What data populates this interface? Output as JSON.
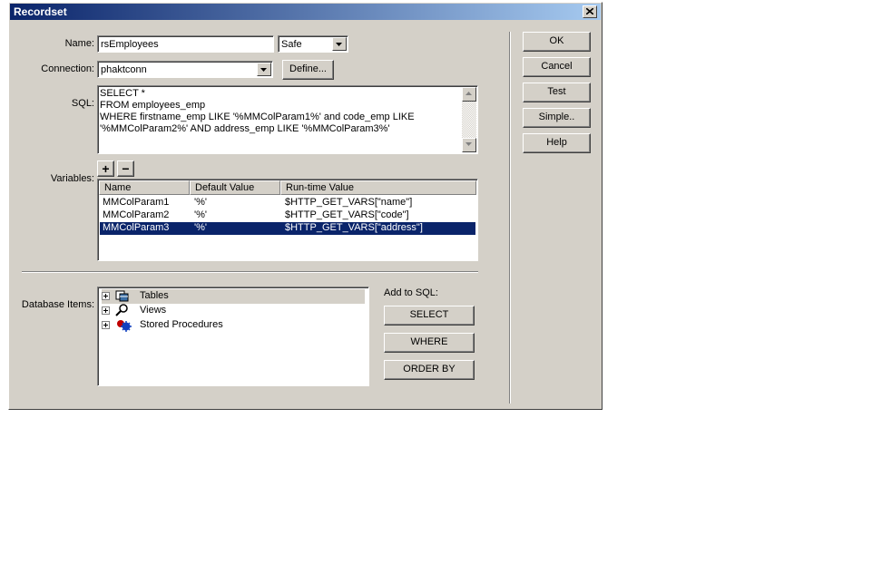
{
  "window": {
    "title": "Recordset"
  },
  "name_field": {
    "label": "Name:",
    "value": "rsEmployees"
  },
  "safety_select": {
    "value": "Safe"
  },
  "connection": {
    "label": "Connection:",
    "value": "phaktconn",
    "define_label": "Define..."
  },
  "sql": {
    "label": "SQL:",
    "lines": [
      "SELECT *",
      "FROM employees_emp",
      "WHERE firstname_emp LIKE '%MMColParam1%' and code_emp LIKE",
      "'%MMColParam2%' AND address_emp LIKE '%MMColParam3%'"
    ]
  },
  "variables": {
    "label": "Variables:",
    "add_label": "+",
    "remove_label": "−",
    "columns": [
      "Name",
      "Default Value",
      "Run-time Value"
    ],
    "rows": [
      {
        "name": "MMColParam1",
        "default": "'%'",
        "runtime": "$HTTP_GET_VARS[\"name\"]"
      },
      {
        "name": "MMColParam2",
        "default": "'%'",
        "runtime": "$HTTP_GET_VARS[\"code\"]"
      },
      {
        "name": "MMColParam3",
        "default": "'%'",
        "runtime": "$HTTP_GET_VARS[\"address\"]"
      }
    ],
    "selected_index": 2
  },
  "database_items": {
    "label": "Database Items:",
    "items": [
      {
        "label": "Tables",
        "icon": "tables-icon"
      },
      {
        "label": "Views",
        "icon": "views-icon"
      },
      {
        "label": "Stored Procedures",
        "icon": "stored-procedures-icon"
      }
    ]
  },
  "add_to_sql": {
    "label": "Add to SQL:",
    "select_label": "SELECT",
    "where_label": "WHERE",
    "order_by_label": "ORDER BY"
  },
  "buttons": {
    "ok": "OK",
    "cancel": "Cancel",
    "test": "Test",
    "simple": "Simple..",
    "help": "Help"
  },
  "colors": {
    "title_start": "#0a246a",
    "title_end": "#a6caf0",
    "face": "#d4d0c8",
    "selection": "#0a246a"
  }
}
